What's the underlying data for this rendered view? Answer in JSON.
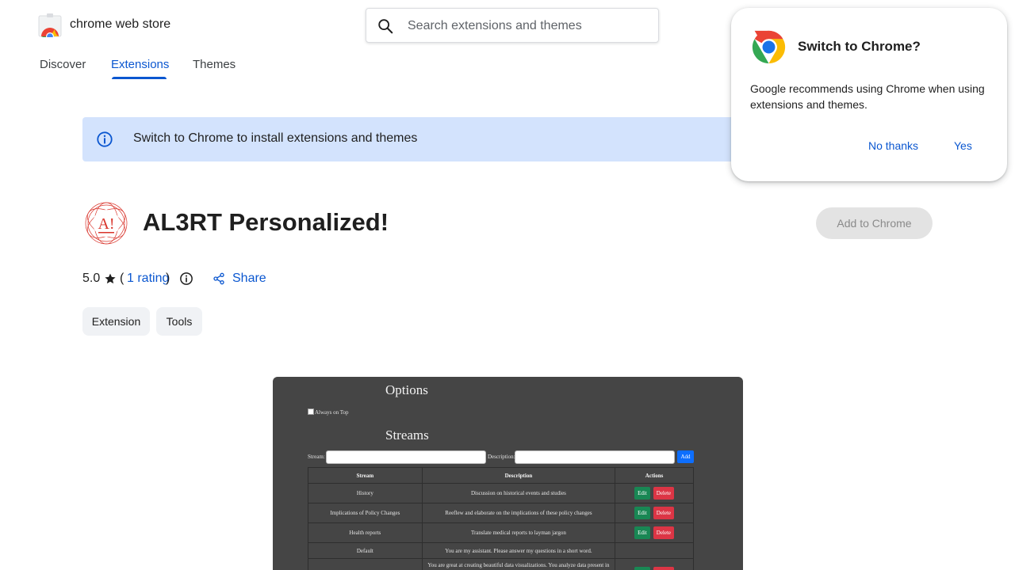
{
  "header": {
    "brand": "chrome web store",
    "search_placeholder": "Search extensions and themes"
  },
  "nav": {
    "tabs": [
      {
        "label": "Discover",
        "active": false
      },
      {
        "label": "Extensions",
        "active": true
      },
      {
        "label": "Themes",
        "active": false
      }
    ]
  },
  "banner": {
    "text": "Switch to Chrome to install extensions and themes"
  },
  "item": {
    "logo_text": "A!",
    "title": "AL3RT Personalized!",
    "add_button": "Add to Chrome",
    "rating_value": "5.0",
    "rating_link": "1 rating",
    "share_label": "Share",
    "chips": [
      "Extension",
      "Tools"
    ]
  },
  "preview": {
    "options_heading": "Options",
    "always_on_top": "Always on Top",
    "streams_heading": "Streams",
    "stream_label": "Stream:",
    "description_label": "Description:",
    "add_label": "Add",
    "columns": [
      "Stream",
      "Description",
      "Actions"
    ],
    "edit_label": "Edit",
    "delete_label": "Delete",
    "rows": [
      {
        "stream": "History",
        "description": "Discussion on historical events and studies",
        "actions": true
      },
      {
        "stream": "Implications of Policy Changes",
        "description": "Reeflew and elaborate on the implications of these policy changes",
        "actions": true
      },
      {
        "stream": "Health reports",
        "description": "Translate medical reports to layman jargon",
        "actions": true
      },
      {
        "stream": "Default",
        "description": "You are my assistant. Please answer my questions in a short word.",
        "actions": false
      },
      {
        "stream": "",
        "description": "You are great at creating beautiful data visualizations. You analyze data present in .csv",
        "actions": true
      }
    ]
  },
  "popup": {
    "title": "Switch to Chrome?",
    "body": "Google recommends using Chrome when using extensions and themes.",
    "no_thanks": "No thanks",
    "yes": "Yes"
  },
  "colors": {
    "accent": "#0b57d0",
    "banner_bg": "#d3e3fd",
    "chip_bg": "#f0f2f5",
    "preview_bg": "#454545"
  }
}
